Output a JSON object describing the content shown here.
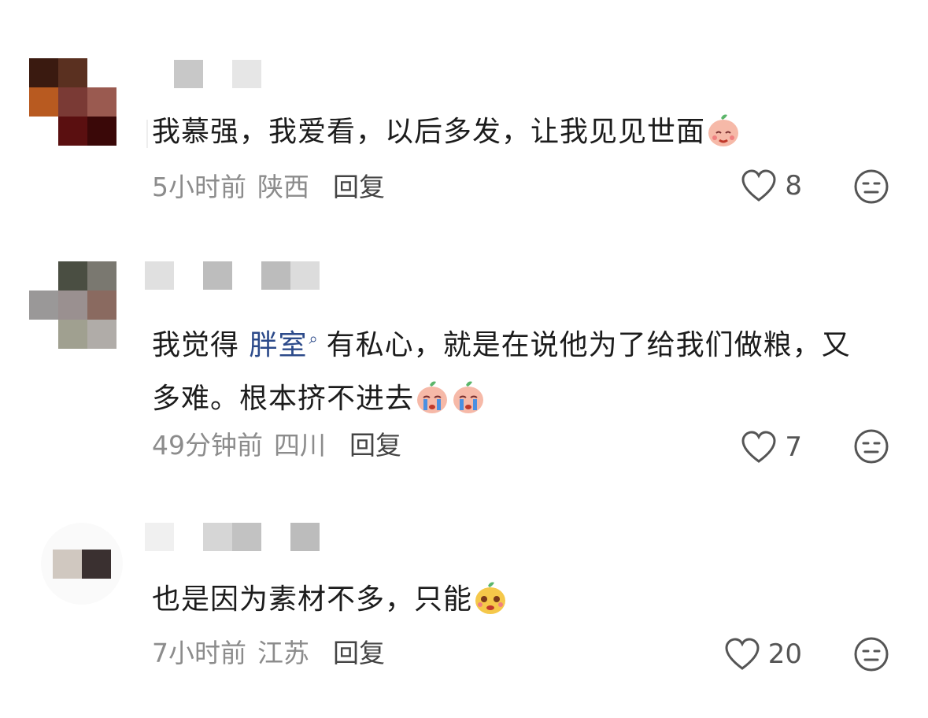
{
  "comments": [
    {
      "text": "我慕强，我爱看，以后多发，让我见见世面",
      "text_parts": null,
      "time": "5小时前",
      "region": "陕西",
      "reply_label": "回复",
      "likes": "8",
      "avatar_colors": [
        "#3a1a10",
        "#5a3020",
        "#ffffff",
        "#b85a20",
        "#7a3a35",
        "#9a5a50",
        "#ffffff",
        "#5a0f10",
        "#3a0808"
      ],
      "name_colors": [
        "#ffffff",
        "#c8c8c8",
        "#ffffff",
        "#e6e6e6"
      ]
    },
    {
      "text_before": "我觉得 ",
      "mention": "胖室",
      "text_after": "有私心，就是在说他为了给我们做粮，又多难。根本挤不进去",
      "time": "49分钟前",
      "region": "四川",
      "reply_label": "回复",
      "likes": "7",
      "avatar_colors": [
        "#ffffff",
        "#4a4e42",
        "#7a7870",
        "#9a9898",
        "#9a9090",
        "#8a6a60",
        "#ffffff",
        "#a0a090",
        "#b0aca8"
      ],
      "name_colors": [
        "#e0e0e0",
        "#ffffff",
        "#bdbdbd",
        "#ffffff",
        "#bcbcbc",
        "#dcdcdc"
      ]
    },
    {
      "text": "也是因为素材不多，只能",
      "time": "7小时前",
      "region": "江苏",
      "reply_label": "回复",
      "likes": "20",
      "avatar_colors": [
        "#d0c8c0",
        "#3a3030"
      ],
      "name_colors": [
        "#f0f0f0",
        "#ffffff",
        "#d6d6d6",
        "#c2c2c2",
        "#ffffff",
        "#bcbcbc"
      ]
    }
  ],
  "icons": {
    "like": "heart-outline-icon",
    "dislike": "meh-face-icon",
    "mention": "search-icon"
  }
}
